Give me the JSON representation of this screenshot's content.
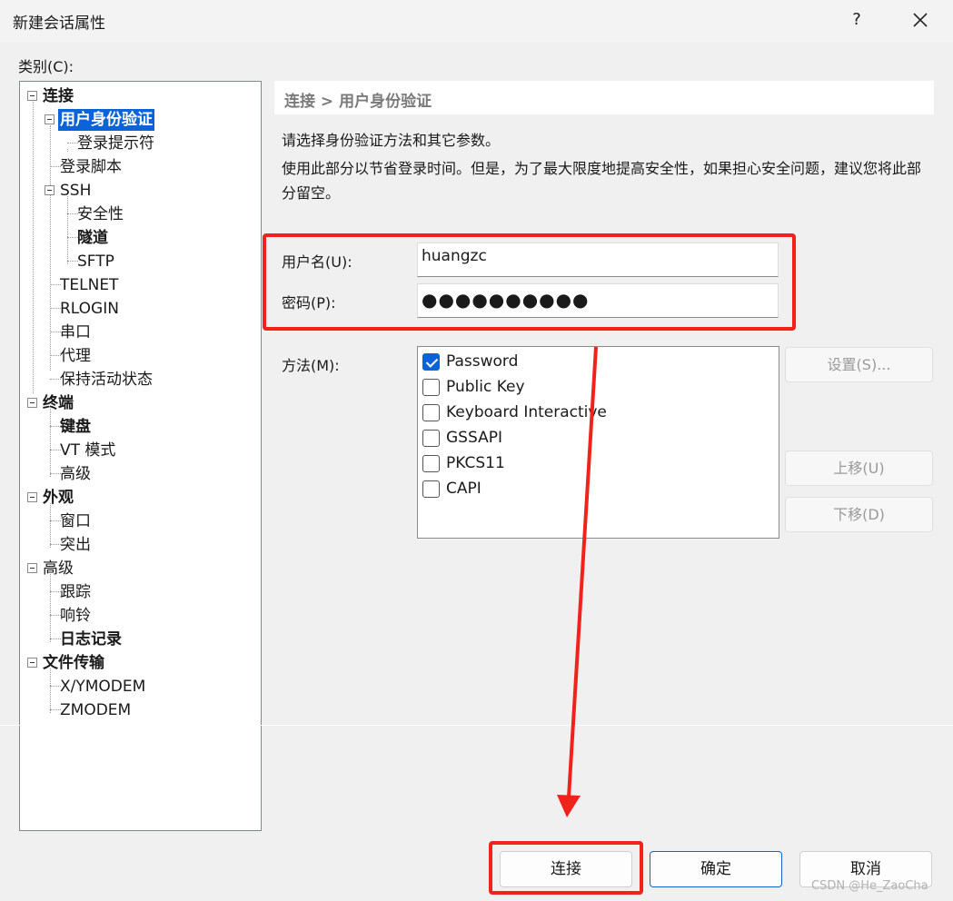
{
  "window": {
    "title": "新建会话属性",
    "help_label": "?"
  },
  "category_label": "类别(C):",
  "tree": [
    {
      "label": "连接",
      "bold": true
    },
    {
      "label": "用户身份验证",
      "bold": true,
      "selected": true
    },
    {
      "label": "登录提示符"
    },
    {
      "label": "登录脚本"
    },
    {
      "label": "SSH"
    },
    {
      "label": "安全性"
    },
    {
      "label": "隧道",
      "bold": true
    },
    {
      "label": "SFTP"
    },
    {
      "label": "TELNET"
    },
    {
      "label": "RLOGIN"
    },
    {
      "label": "串口"
    },
    {
      "label": "代理"
    },
    {
      "label": "保持活动状态"
    },
    {
      "label": "终端",
      "bold": true
    },
    {
      "label": "键盘",
      "bold": true
    },
    {
      "label": "VT 模式"
    },
    {
      "label": "高级"
    },
    {
      "label": "外观",
      "bold": true
    },
    {
      "label": "窗口"
    },
    {
      "label": "突出"
    },
    {
      "label": "高级"
    },
    {
      "label": "跟踪"
    },
    {
      "label": "响铃"
    },
    {
      "label": "日志记录",
      "bold": true
    },
    {
      "label": "文件传输",
      "bold": true
    },
    {
      "label": "X/YMODEM"
    },
    {
      "label": "ZMODEM"
    }
  ],
  "breadcrumb": "连接 > 用户身份验证",
  "description": {
    "line1": "请选择身份验证方法和其它参数。",
    "line2": "使用此部分以节省登录时间。但是，为了最大限度地提高安全性，如果担心安全问题，建议您将此部分留空。"
  },
  "form": {
    "username_label": "用户名(U):",
    "username_value": "huangzc",
    "password_label": "密码(P):",
    "password_value": "●●●●●●●●●●",
    "method_label": "方法(M):"
  },
  "methods": [
    {
      "label": "Password",
      "checked": true
    },
    {
      "label": "Public Key",
      "checked": false
    },
    {
      "label": "Keyboard Interactive",
      "checked": false
    },
    {
      "label": "GSSAPI",
      "checked": false
    },
    {
      "label": "PKCS11",
      "checked": false
    },
    {
      "label": "CAPI",
      "checked": false
    }
  ],
  "side_buttons": {
    "settings": "设置(S)...",
    "move_up": "上移(U)",
    "move_down": "下移(D)"
  },
  "bottom_buttons": {
    "connect": "连接",
    "ok": "确定",
    "cancel": "取消"
  },
  "watermark": "CSDN @He_ZaoCha",
  "colors": {
    "accent": "#0a64d8",
    "annotation_red": "#f0231c"
  }
}
